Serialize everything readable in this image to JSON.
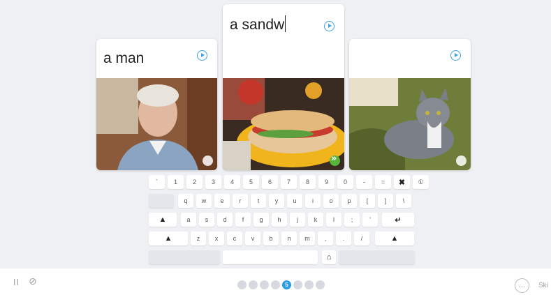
{
  "cards": [
    {
      "word": "a man",
      "image": "photo-older-man",
      "corner": "white"
    },
    {
      "word": "a sandw",
      "image": "photo-sandwich",
      "corner": "green"
    },
    {
      "word": "",
      "image": "photo-gray-cat",
      "corner": "white"
    }
  ],
  "keyboard": {
    "row1": [
      "`",
      "1",
      "2",
      "3",
      "4",
      "5",
      "6",
      "7",
      "8",
      "9",
      "0",
      "-",
      "="
    ],
    "row2": [
      "q",
      "w",
      "e",
      "r",
      "t",
      "y",
      "u",
      "i",
      "o",
      "p",
      "[",
      "]",
      "\\"
    ],
    "row3": [
      "a",
      "s",
      "d",
      "f",
      "g",
      "h",
      "j",
      "k",
      "l",
      ";",
      "'"
    ],
    "row4": [
      "z",
      "x",
      "c",
      "v",
      "b",
      "n",
      "m",
      ",",
      ".",
      "/"
    ],
    "icons": {
      "backspace": "✖",
      "info": "①",
      "shift": "▲",
      "enter": "↵",
      "home": "⌂"
    }
  },
  "footer": {
    "pause_icon": "II",
    "hide_icon": "⊘",
    "progress": {
      "total": 8,
      "current": 5,
      "current_label": "5"
    },
    "more_icon": "…",
    "skip_label": "Ski"
  }
}
